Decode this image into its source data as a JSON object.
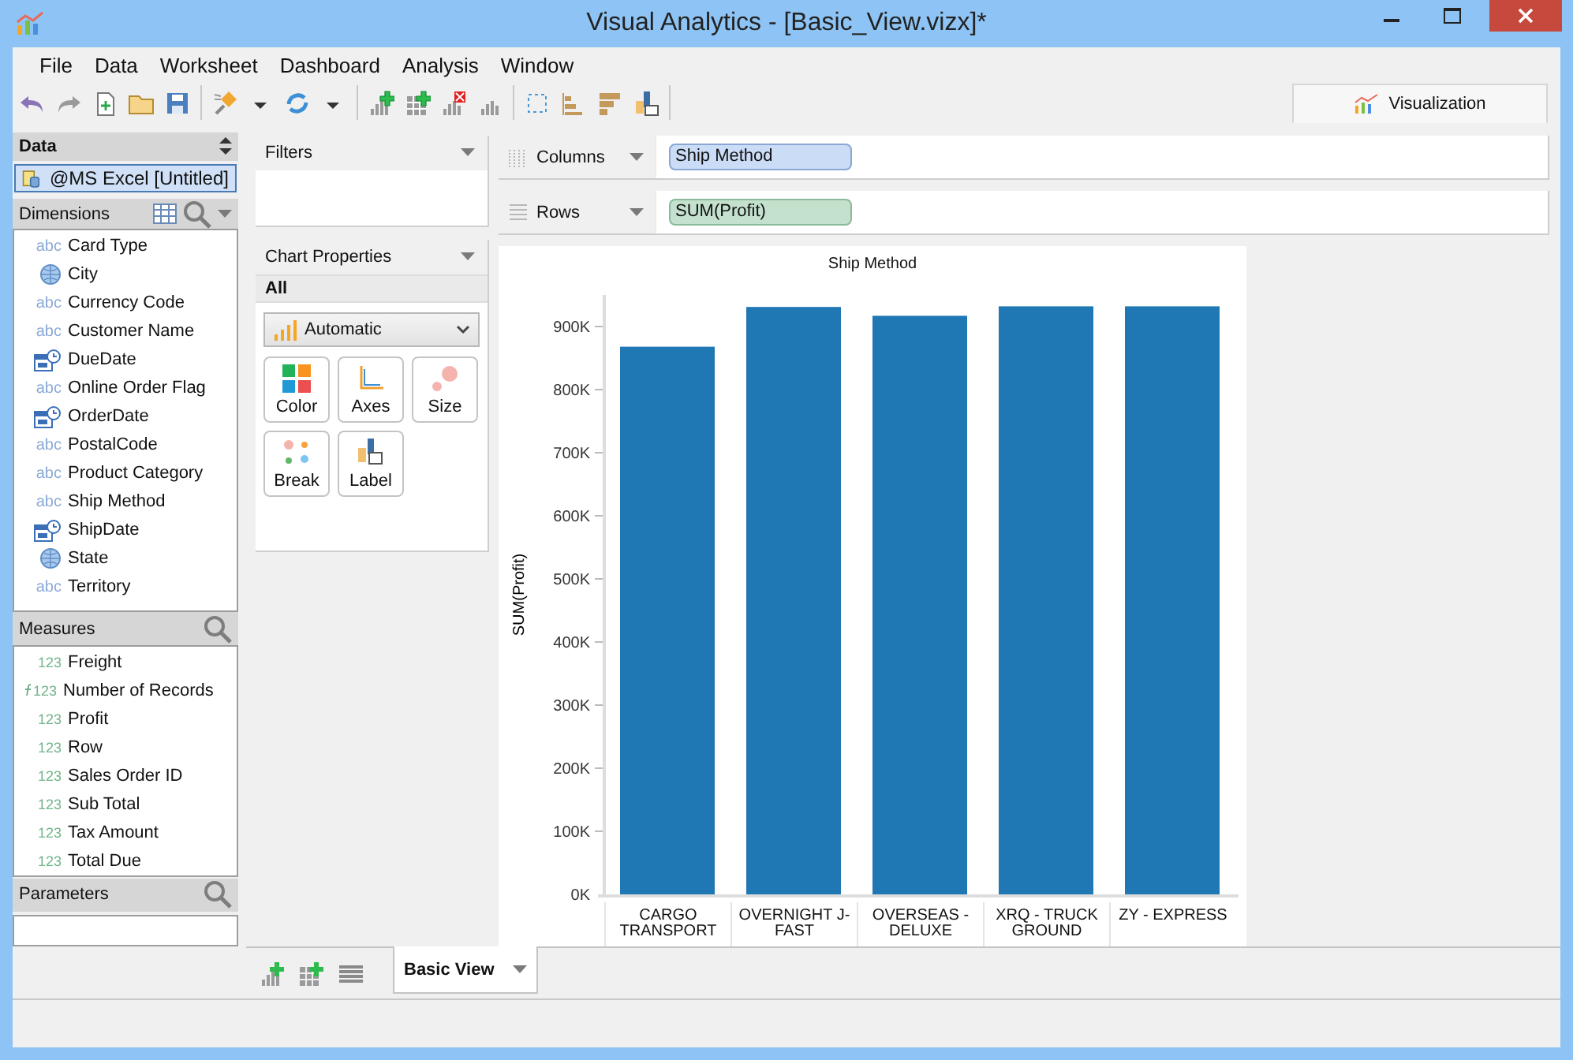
{
  "window": {
    "title": "Visual Analytics - [Basic_View.vizx]*"
  },
  "menu": [
    "File",
    "Data",
    "Worksheet",
    "Dashboard",
    "Analysis",
    "Window"
  ],
  "view_tab": {
    "label": "Visualization",
    "selected": true
  },
  "data_panel": {
    "title": "Data",
    "source": {
      "label": "@MS Excel [Untitled]",
      "selected": true
    }
  },
  "dimensions": {
    "title": "Dimensions",
    "items": [
      {
        "kind": "text",
        "badge": "abc",
        "label": "Card Type"
      },
      {
        "kind": "geo",
        "label": "City"
      },
      {
        "kind": "text",
        "badge": "abc",
        "label": "Currency Code"
      },
      {
        "kind": "text",
        "badge": "abc",
        "label": "Customer Name"
      },
      {
        "kind": "date",
        "label": "DueDate"
      },
      {
        "kind": "text",
        "badge": "abc",
        "label": "Online Order Flag"
      },
      {
        "kind": "date",
        "label": "OrderDate"
      },
      {
        "kind": "text",
        "badge": "abc",
        "label": "PostalCode"
      },
      {
        "kind": "text",
        "badge": "abc",
        "label": "Product Category"
      },
      {
        "kind": "text",
        "badge": "abc",
        "label": "Ship Method"
      },
      {
        "kind": "date",
        "label": "ShipDate"
      },
      {
        "kind": "geo",
        "label": "State"
      },
      {
        "kind": "text",
        "badge": "abc",
        "label": "Territory"
      }
    ]
  },
  "measures": {
    "title": "Measures",
    "items": [
      {
        "kind": "number",
        "badge": "123",
        "label": "Freight"
      },
      {
        "kind": "calculated",
        "badge": "123",
        "label": "Number of Records"
      },
      {
        "kind": "number",
        "badge": "123",
        "label": "Profit"
      },
      {
        "kind": "number",
        "badge": "123",
        "label": "Row"
      },
      {
        "kind": "number",
        "badge": "123",
        "label": "Sales Order ID"
      },
      {
        "kind": "number",
        "badge": "123",
        "label": "Sub Total"
      },
      {
        "kind": "number",
        "badge": "123",
        "label": "Tax Amount"
      },
      {
        "kind": "number",
        "badge": "123",
        "label": "Total Due"
      }
    ]
  },
  "parameters": {
    "title": "Parameters"
  },
  "filters": {
    "title": "Filters"
  },
  "chart_properties": {
    "title": "Chart Properties",
    "scope": "All",
    "mark_type": "Automatic",
    "buttons": [
      {
        "kind": "color",
        "label": "Color"
      },
      {
        "kind": "axes",
        "label": "Axes"
      },
      {
        "kind": "size",
        "label": "Size"
      },
      {
        "kind": "break",
        "label": "Break"
      },
      {
        "kind": "label",
        "label": "Label"
      }
    ]
  },
  "shelves": [
    {
      "label": "Columns",
      "kind": "dimension",
      "pill": "Ship Method"
    },
    {
      "label": "Rows",
      "kind": "measure",
      "pill": "SUM(Profit)"
    }
  ],
  "chart": {
    "chart_data": {
      "type": "bar",
      "title": "Ship Method",
      "ylabel": "SUM(Profit)",
      "categories": [
        "CARGO TRANSPORT",
        "OVERNIGHT J-FAST",
        "OVERSEAS - DELUXE",
        "XRQ - TRUCK GROUND",
        "ZY - EXPRESS"
      ],
      "values": [
        868000,
        931000,
        917000,
        932000,
        932000
      ],
      "ylim": [
        0,
        950000
      ],
      "yticks": [
        {
          "value": 0,
          "label": "0K"
        },
        {
          "value": 100000,
          "label": "100K"
        },
        {
          "value": 200000,
          "label": "200K"
        },
        {
          "value": 300000,
          "label": "300K"
        },
        {
          "value": 400000,
          "label": "400K"
        },
        {
          "value": 500000,
          "label": "500K"
        },
        {
          "value": 600000,
          "label": "600K"
        },
        {
          "value": 700000,
          "label": "700K"
        },
        {
          "value": 800000,
          "label": "800K"
        },
        {
          "value": 900000,
          "label": "900K"
        }
      ]
    }
  },
  "sheet_tabs": [
    {
      "label": "Basic View",
      "selected": true
    }
  ]
}
